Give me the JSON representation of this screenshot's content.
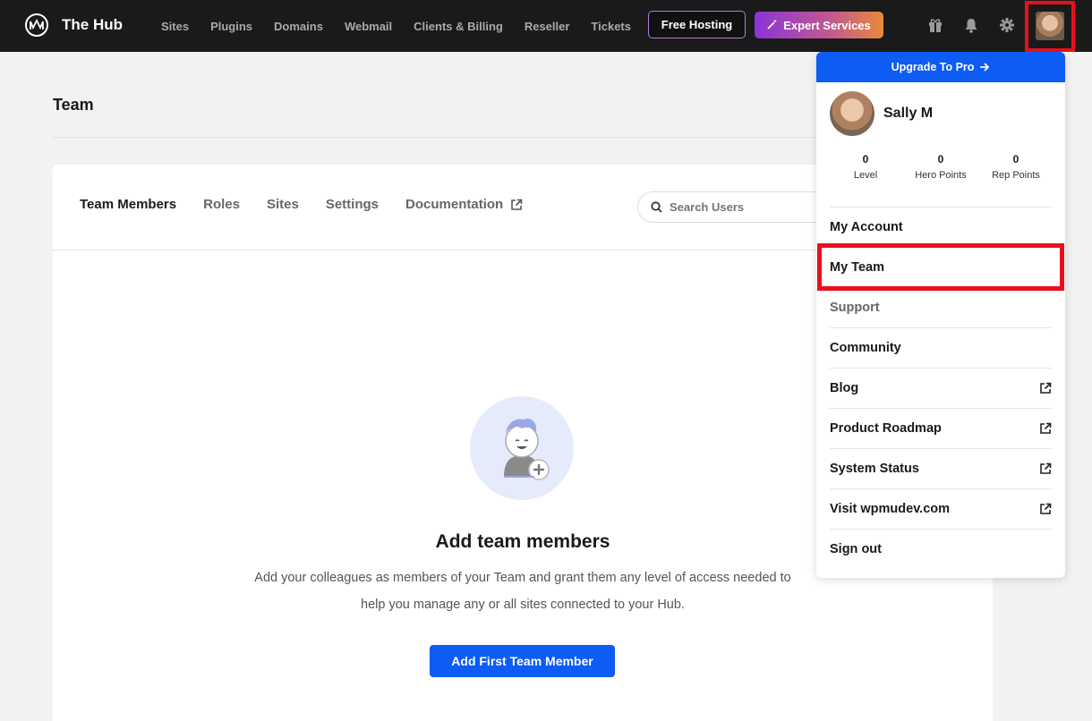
{
  "topbar": {
    "brand": "The Hub",
    "nav": [
      "Sites",
      "Plugins",
      "Domains",
      "Webmail",
      "Clients & Billing",
      "Reseller",
      "Tickets"
    ],
    "free_hosting": "Free Hosting",
    "expert_services": "Expert Services",
    "icons": [
      "gift-icon",
      "bell-icon",
      "gear-icon",
      "user-avatar"
    ]
  },
  "page": {
    "title": "Team",
    "tabs": [
      "Team Members",
      "Roles",
      "Sites",
      "Settings",
      "Documentation"
    ],
    "search_placeholder": "Search Users",
    "empty_title": "Add team members",
    "empty_desc": "Add your colleagues as members of your Team and grant them any level of access needed to help you manage any or all sites connected to your Hub.",
    "add_button": "Add First Team Member"
  },
  "dropdown": {
    "upgrade": "Upgrade To Pro",
    "user_name": "Sally M",
    "stats": [
      {
        "value": "0",
        "label": "Level"
      },
      {
        "value": "0",
        "label": "Hero Points"
      },
      {
        "value": "0",
        "label": "Rep Points"
      }
    ],
    "menu": [
      {
        "label": "My Account",
        "external": false
      },
      {
        "label": "My Team",
        "external": false
      },
      {
        "label": "Support",
        "external": false
      },
      {
        "label": "Community",
        "external": false
      },
      {
        "label": "Blog",
        "external": true
      },
      {
        "label": "Product Roadmap",
        "external": true
      },
      {
        "label": "System Status",
        "external": true
      },
      {
        "label": "Visit wpmudev.com",
        "external": true
      },
      {
        "label": "Sign out",
        "external": false
      }
    ]
  },
  "colors": {
    "accent": "#0d5cf3",
    "highlight": "#e8101c",
    "topbar": "#1a1a1a"
  }
}
